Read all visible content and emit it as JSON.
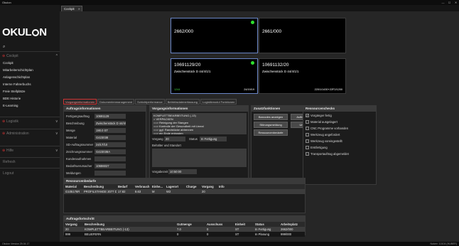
{
  "app": {
    "title": "Okulon"
  },
  "window": {
    "min": "—",
    "max": "☐",
    "close": "✕"
  },
  "sidebar": {
    "logo_pre": "OKUL",
    "logo_post": "N",
    "search_icon": "⌕",
    "sections": {
      "cockpit": {
        "label": "Cockpit",
        "icon": "cockpit-icon",
        "chevron": "^",
        "items": [
          "Cockpit",
          "Mitarbeiterschichtplan",
          "Anlagenschichtplan",
          "Interne Fahrerbuchs",
          "Freie Stellplätze",
          "BDE Historie",
          "E-Learning"
        ]
      },
      "logistik": {
        "label": "Logistik",
        "chevron": "v"
      },
      "administration": {
        "label": "Administration",
        "chevron": "v"
      },
      "hilfe": {
        "label": "Hilfe",
        "chevron": "v"
      }
    },
    "refresh": "Refresh",
    "logout": "Logout"
  },
  "doc_tab": {
    "label": "Cockpit",
    "close": "✕"
  },
  "workplaces": [
    {
      "number": "2662/000",
      "status_color": "#2ee02e",
      "selected": true
    },
    {
      "number": "2661/000"
    },
    {
      "number": "10691129/20",
      "subtitle": "Zwischenstück D 44/4/1/1",
      "left": "1244",
      "right": "24/19/19",
      "selected": true
    },
    {
      "number": "10691132/20",
      "subtitle": "Zwischenstück D 44/4/1/1",
      "right": "220/1/1430+22F2/1200"
    }
  ],
  "tabs": [
    "Vorgangsinformationen",
    "Dokumentenmanagement",
    "Schichtperformance",
    "Betriebsdatenerfassung",
    "Logistikmodul Funktionen"
  ],
  "auftrag": {
    "title": "Auftragsinformationen",
    "fields": [
      {
        "label": "Fertigungsauftrag",
        "value": "10691129"
      },
      {
        "label": "Beschreibung",
        "value": "Zwischenstück D 44/4/1/1"
      },
      {
        "label": "Menge",
        "value": "190.0 ST"
      },
      {
        "label": "Material",
        "value": "G423038"
      },
      {
        "label": "SD-Auftragsnummer",
        "value": "24/LT/10"
      },
      {
        "label": "Zeichnungsnummer",
        "value": "G423038A"
      },
      {
        "label": "Kundenaufnahmen",
        "value": ""
      },
      {
        "label": "Bedarfsverursacher",
        "value": "10686027"
      },
      {
        "label": "Meldungen",
        "value": ""
      }
    ]
  },
  "vorgang": {
    "title": "Vorgangsinformationen",
    "lines": [
      "KOMPLETTBEARBEITUNG (-13)",
      "> VERPACKEN",
      "==> Reinigung der Stangen",
      "==> Kontrolle der Gesundheit mit Lineal",
      "==> ggf. Randstücke abtrennen",
      "==> ein Ende entrosten"
    ],
    "vorgang_label": "Vorgang",
    "vorgang_value": "20",
    "status_label": "Status",
    "status_value": "In Fertigung",
    "behaelter_label": "Behälter und Standort",
    "vorgabezeit_label": "Vorgabezeit",
    "vorgabezeit_value": "10:50:00"
  },
  "zusatz": {
    "title": "Zusatzfunktionen",
    "buttons": [
      "Barcodes anzeigen",
      "Auftragsbestellung",
      "Störungsmeldung",
      "Unterstützung",
      "Ressourcenbedarfe"
    ]
  },
  "ressourcen": {
    "title": "Ressourcenchecks",
    "items": [
      {
        "label": "Vorgänger fertig",
        "checked": true
      },
      {
        "label": "Material ausgelagert",
        "checked": false
      },
      {
        "label": "CNC Programme vorhanden",
        "checked": false
      },
      {
        "label": "Werkzeug angefordert",
        "checked": false
      },
      {
        "label": "Werkzeug voreingestellt",
        "checked": false
      },
      {
        "label": "Erstfertigung",
        "checked": false
      },
      {
        "label": "Transportauftrag abgemeldet",
        "checked": false
      }
    ]
  },
  "bedarfe": {
    "title": "Ressourcenbedarfe",
    "columns": [
      "Material",
      "Beschreibung",
      "Bedarf",
      "Verbrauch",
      "Einhe...",
      "Lagerort",
      "Charge",
      "Vorgang",
      "Info"
    ],
    "rows": [
      [
        "G105176R",
        "PROFILSTANGE 2077 D...",
        "17.82",
        "8.63",
        "M",
        "W2",
        "",
        "20",
        ""
      ]
    ]
  },
  "fortschritt": {
    "title": "Auftragsfortschritt",
    "columns": [
      "Vorgang",
      "Beschreibung",
      "Gutmenge",
      "Ausschuss",
      "Einheit",
      "Status",
      "Arbeitsplatz"
    ],
    "rows": [
      [
        "20",
        "KOMPLETTBEARBEITUNG (-13)",
        "7.0",
        "0",
        "ST",
        "In Fertigung",
        "2662/000"
      ],
      [
        "999",
        "BELIEFERN",
        "0",
        "0",
        "ST",
        "In Planung",
        "999/000"
      ]
    ]
  },
  "status_bar": {
    "left": "Okulon Version 25.04.17",
    "right": "Nutzer: 10104 (HUBER)"
  }
}
